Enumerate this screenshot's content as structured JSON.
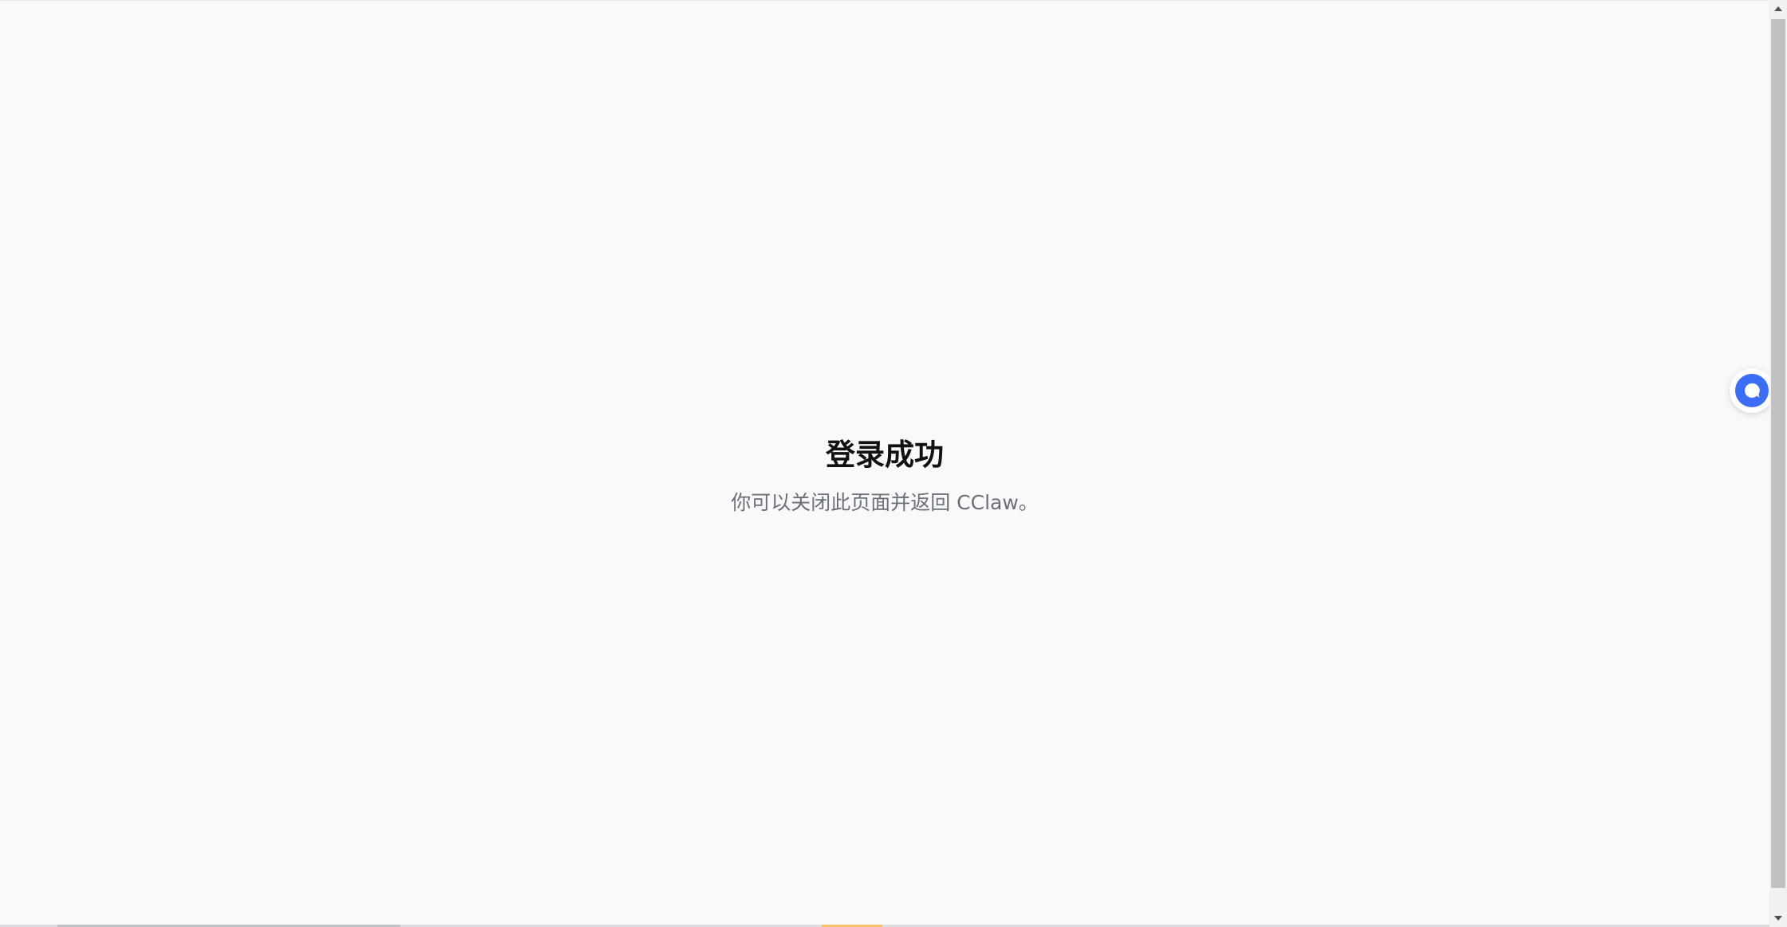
{
  "page": {
    "title": "登录成功",
    "message": "你可以关闭此页面并返回 CClaw。"
  },
  "assistant_button": {
    "icon": "chat-bubble-icon",
    "color": "#3b6ef5"
  },
  "colors": {
    "background": "#f8f9fa",
    "title": "#111111",
    "message": "#6b6f76",
    "accent": "#3b6ef5"
  }
}
